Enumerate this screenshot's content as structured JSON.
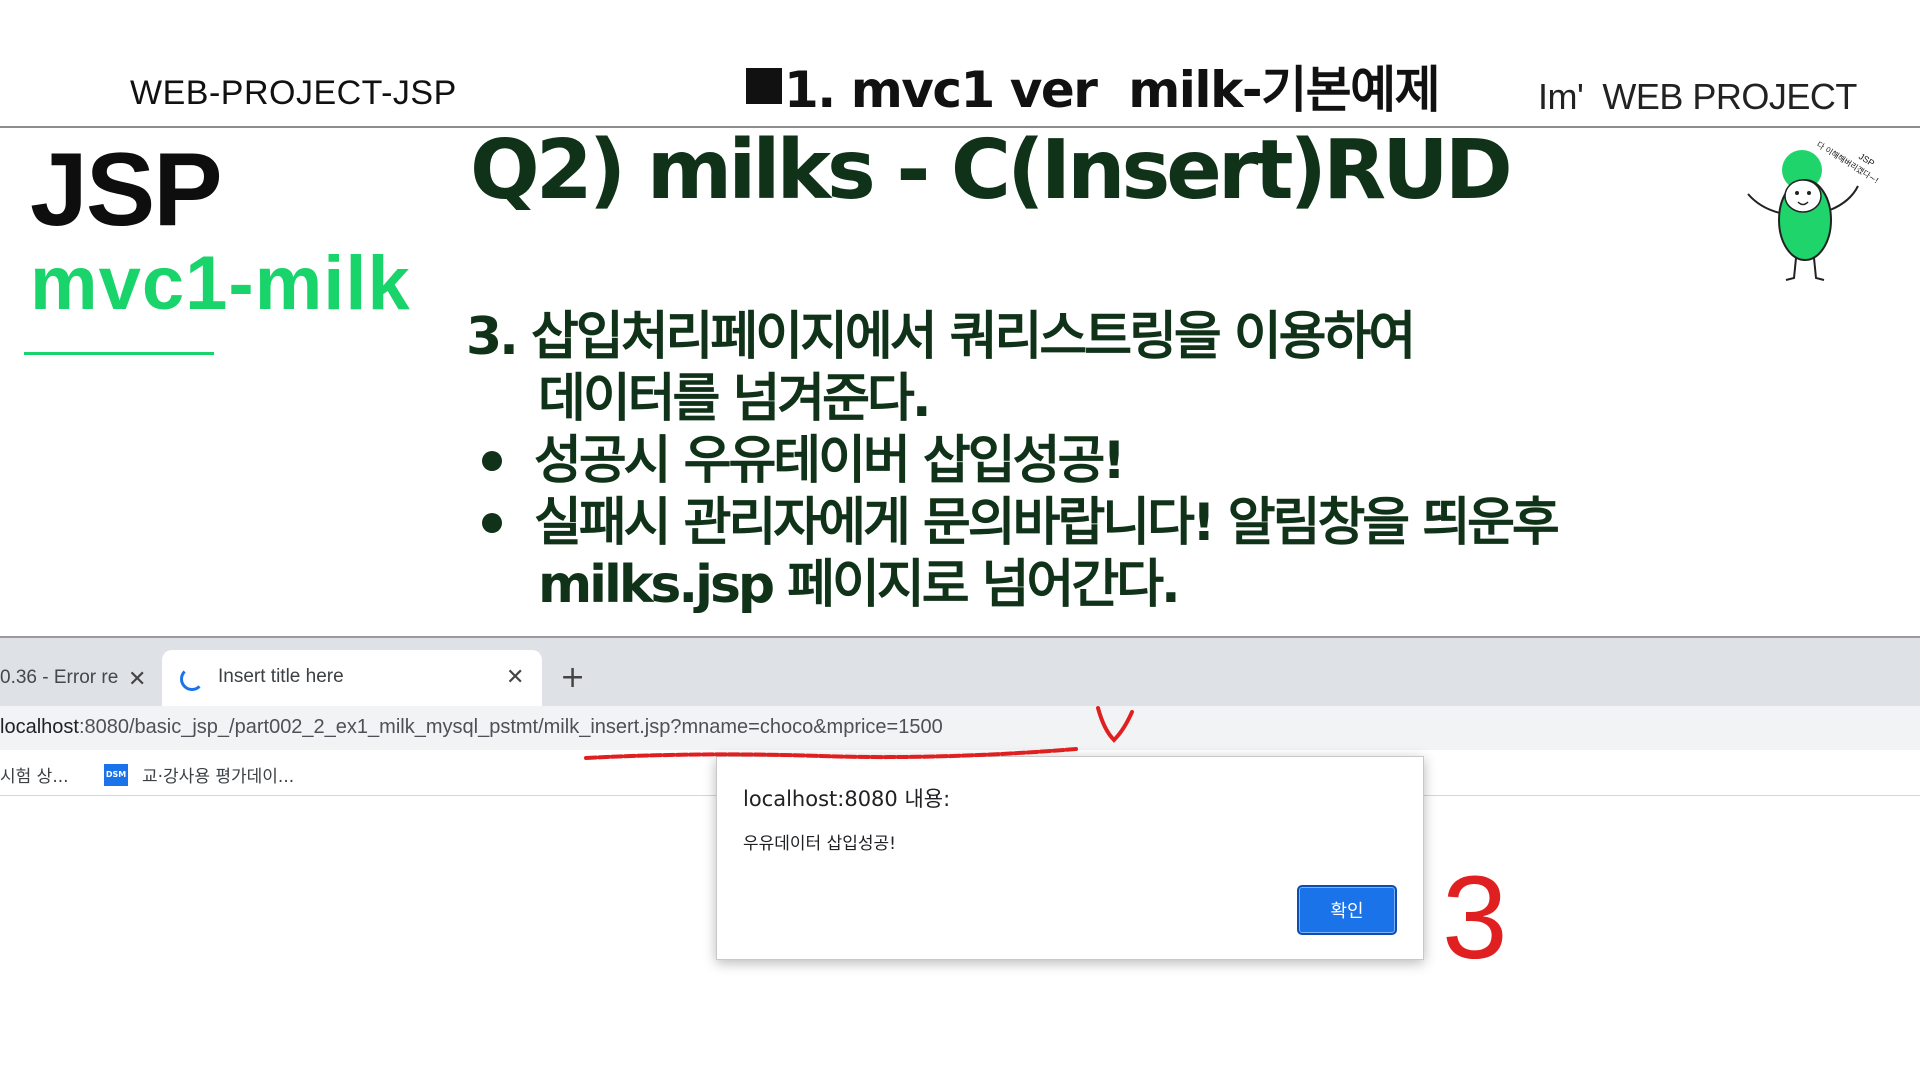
{
  "header": {
    "left": "WEB-PROJECT-JSP",
    "center": "1. mvc1 ver  milk-기본예제",
    "right": "Im'  WEB PROJECT"
  },
  "sidebar": {
    "title": "JSP",
    "subtitle": "mvc1-milk"
  },
  "main": {
    "question": "Q2) milks - C(Insert)RUD",
    "step_line1": "3. 삽입처리페이지에서 쿼리스트링을 이용하여",
    "step_line2": "데이터를 넘겨준다.",
    "bullet1": "성공시 우유테이버 삽입성공!",
    "bullet2": "실패시 관리자에게 문의바랍니다! 알림창을 띄운후",
    "bullet2_cont": "milks.jsp 페이지로 넘어간다."
  },
  "mascot": {
    "caption_line1": "JSP",
    "caption_line2": "다 이해해버리겠다~!"
  },
  "browser": {
    "tabs": [
      {
        "title": "0.36 - Error re",
        "active": false
      },
      {
        "title": "Insert title here",
        "active": true
      }
    ],
    "new_tab": "+",
    "close_glyph": "✕",
    "url_host": "localhost",
    "url_rest": ":8080/basic_jsp_/part002_2_ex1_milk_mysql_pstmt/milk_insert.jsp?mname=choco&mprice=1500",
    "bookmarks": [
      {
        "label": "시험 상..."
      },
      {
        "label": "교·강사용 평가데이...",
        "icon": "DSM"
      }
    ],
    "dialog": {
      "title": "localhost:8080 내용:",
      "message": "우유데이터 삽입성공!",
      "ok": "확인"
    }
  },
  "annotations": {
    "mark": "3",
    "color": "#e02020"
  }
}
